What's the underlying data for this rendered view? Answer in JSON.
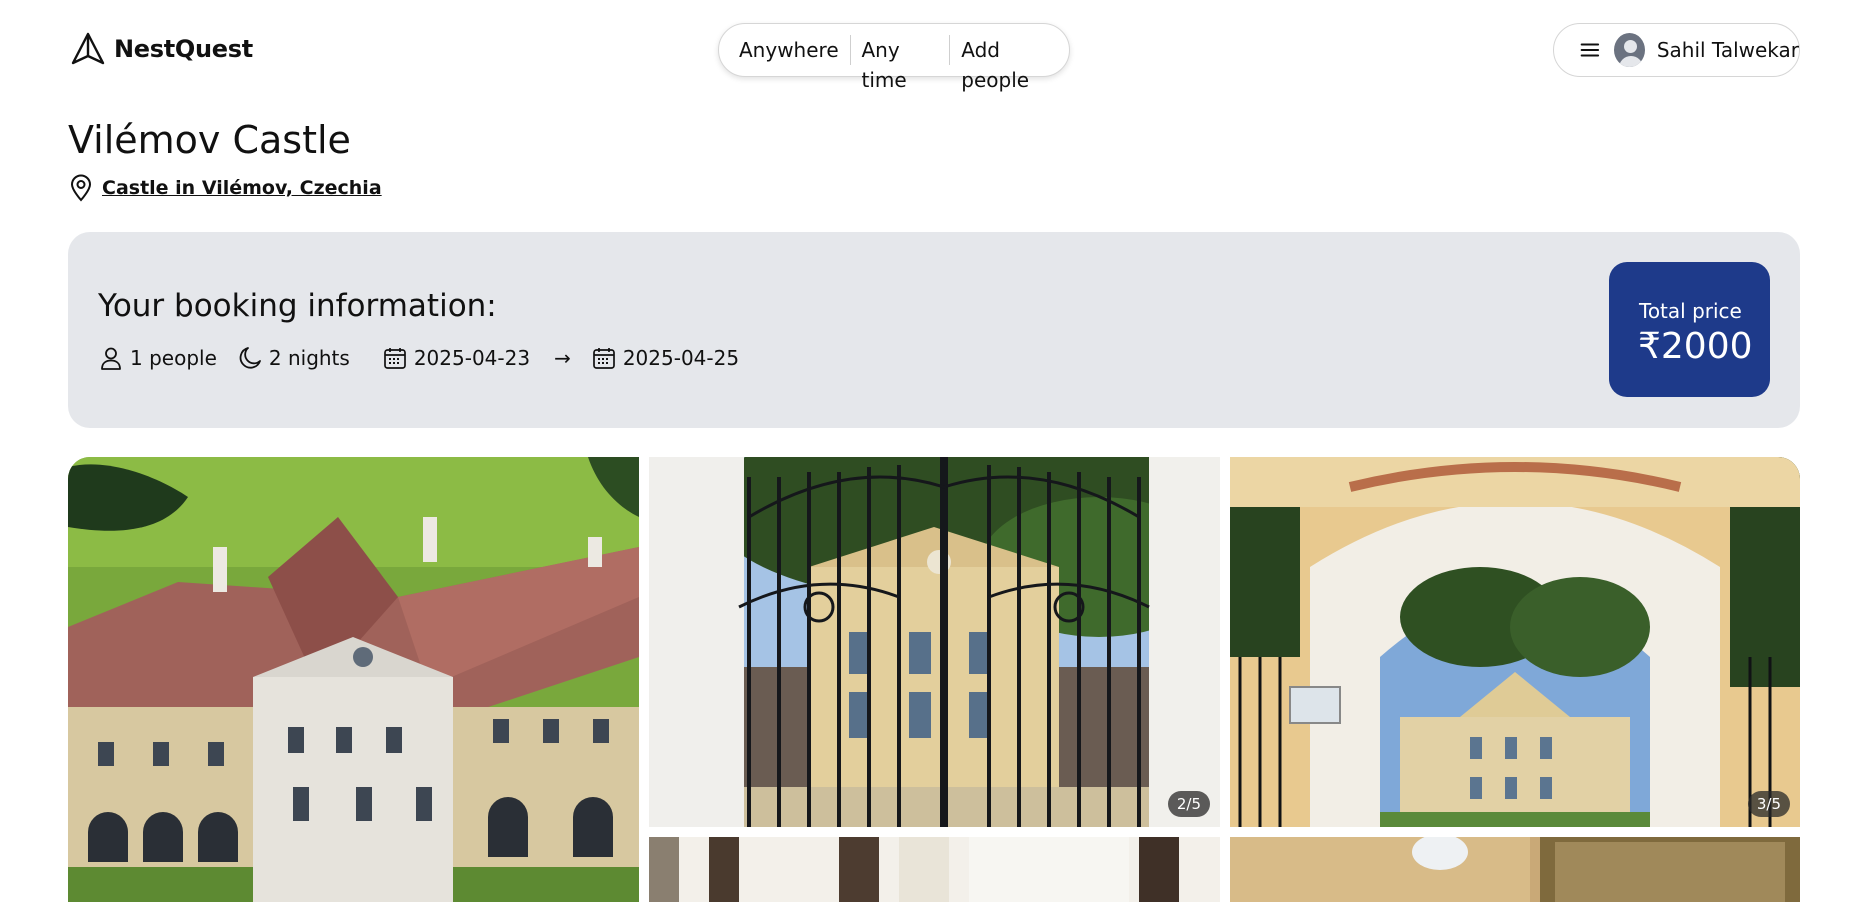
{
  "brand": {
    "name": "NestQuest"
  },
  "search": {
    "anywhere": "Anywhere",
    "any_time": "Any time",
    "add_people": "Add people"
  },
  "user": {
    "name": "Sahil Talwekar"
  },
  "listing": {
    "title": "Vilémov Castle",
    "location": "Castle in Vilémov, Czechia"
  },
  "booking": {
    "heading": "Your booking information:",
    "people": "1 people",
    "nights": "2 nights",
    "check_in": "2025-04-23",
    "arrow": "→",
    "check_out": "2025-04-25",
    "total_label": "Total price",
    "total_value": "₹2000"
  },
  "gallery": {
    "counters": [
      "2/5",
      "3/5"
    ]
  },
  "colors": {
    "accent": "#1e3a8a",
    "card_bg": "#e5e7eb"
  }
}
